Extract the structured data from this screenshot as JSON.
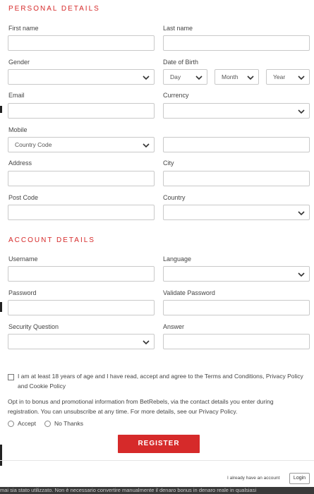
{
  "personal": {
    "title": "PERSONAL DETAILS",
    "first_name": "First name",
    "last_name": "Last name",
    "gender": "Gender",
    "dob": "Date of Birth",
    "day": "Day",
    "month": "Month",
    "year": "Year",
    "email": "Email",
    "currency": "Currency",
    "mobile": "Mobile",
    "country_code": "Country Code",
    "address": "Address",
    "city": "City",
    "post_code": "Post Code",
    "country": "Country"
  },
  "account": {
    "title": "ACCOUNT DETAILS",
    "username": "Username",
    "language": "Language",
    "password": "Password",
    "validate_password": "Validate Password",
    "security_question": "Security Question",
    "answer": "Answer"
  },
  "consent": {
    "age_text": "I am at least 18 years of age and I have read, accept and agree to the Terms and Conditions, Privacy Policy and Cookie Policy",
    "optin_text": "Opt in to bonus and promotional information from BetRebels, via the contact details you enter during registration. You can unsubscribe at any time. For more details, see our Privacy Policy.",
    "accept": "Accept",
    "no_thanks": "No Thanks"
  },
  "actions": {
    "register": "REGISTER",
    "already_account": "I already have an account",
    "login": "Login"
  },
  "background_text": "mai sia stato utilizzato. Non è necessario convertire manualmente il denaro bonus in denaro reale in qualsiasi",
  "colors": {
    "accent": "#d62a2a",
    "border": "#c9c9c9",
    "text": "#444444"
  }
}
